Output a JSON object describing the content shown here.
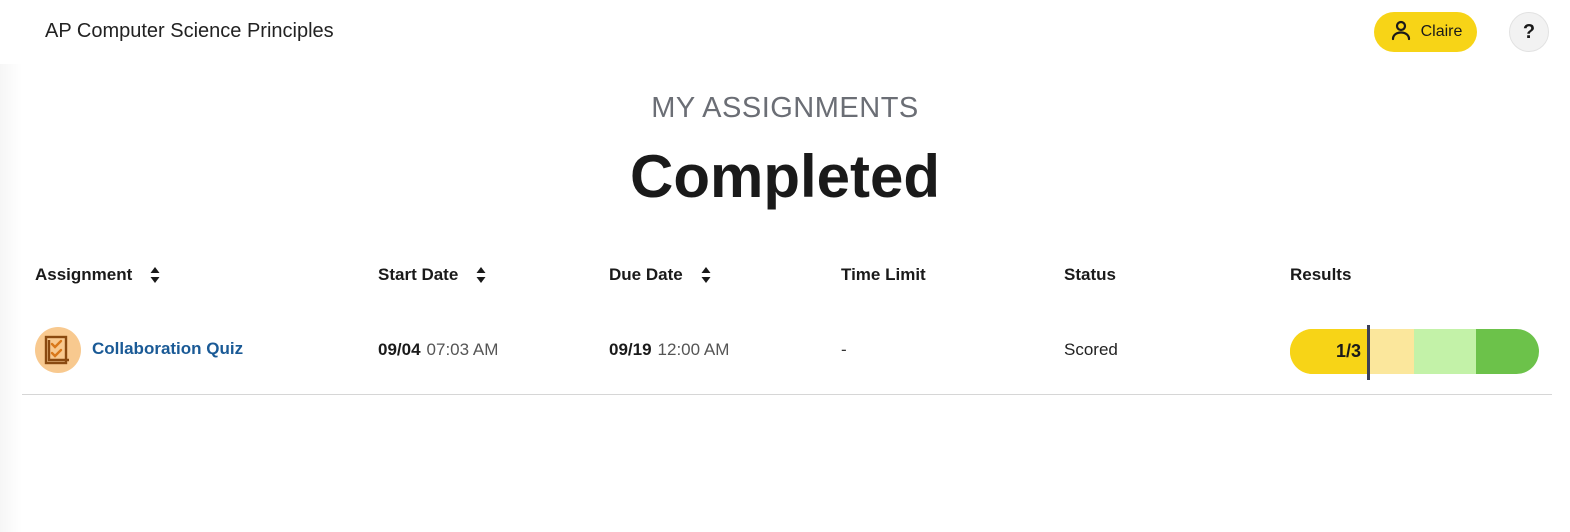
{
  "header": {
    "course_title": "AP Computer Science Principles",
    "user_name": "Claire",
    "help_label": "?"
  },
  "page": {
    "eyebrow": "MY ASSIGNMENTS",
    "title": "Completed"
  },
  "table": {
    "columns": [
      "Assignment",
      "Start Date",
      "Due Date",
      "Time Limit",
      "Status",
      "Results"
    ],
    "rows": [
      {
        "assignment": "Collaboration Quiz",
        "icon": "quiz-checklist-icon",
        "start_date": "09/04",
        "start_time": "07:03 AM",
        "due_date": "09/19",
        "due_time": "12:00 AM",
        "time_limit": "-",
        "status": "Scored",
        "result": "1/3",
        "result_fraction": 0.333
      }
    ]
  },
  "colors": {
    "accent_yellow": "#f7d417",
    "link_blue": "#1a5a96",
    "quiz_icon_bg": "#f8c98f",
    "result_levels": [
      "#f7d417",
      "#fbe79c",
      "#c3f2a8",
      "#6cc24a"
    ]
  }
}
